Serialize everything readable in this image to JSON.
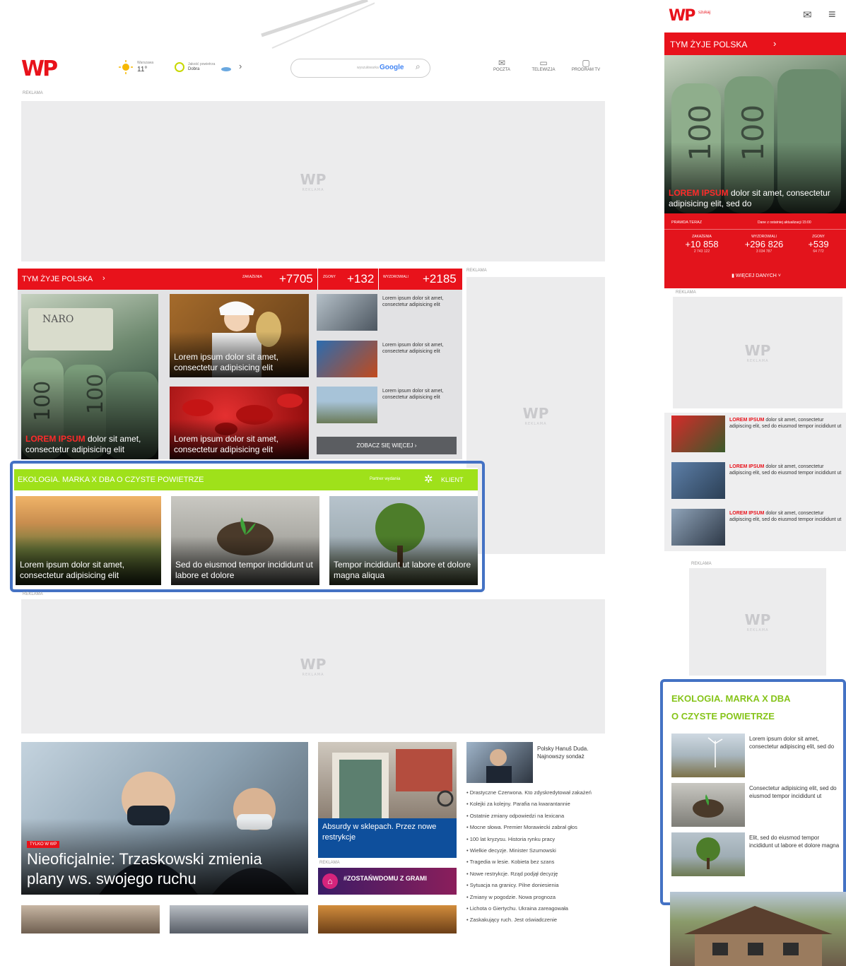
{
  "header": {
    "weather_label": "Warszawa",
    "weather_temp": "11°",
    "air_label": "Jakość powietrza",
    "air_value": "Dobra",
    "search_brand": "Google",
    "search_prefix": "wyszukiwarka",
    "nav": [
      {
        "label": "POCZTA",
        "icon": "mail-icon"
      },
      {
        "label": "TELEWIZJA",
        "icon": "tv-icon"
      },
      {
        "label": "PROGRAM TV",
        "icon": "calendar-icon"
      }
    ],
    "ad_label": "REKLAMA"
  },
  "placeholder": {
    "logo": "WP",
    "sub": "REKLAMA"
  },
  "poland_section": {
    "title": "TYM ŻYJE POLSKA",
    "stats": [
      {
        "label": "ZAKAŻENIA",
        "value": "+7705"
      },
      {
        "label": "ZGONY",
        "value": "+132"
      },
      {
        "label": "WYZDROWIALI",
        "value": "+2185"
      }
    ],
    "big_story": {
      "highlight": "LOREM IPSUM",
      "text": " dolor sit amet, consectetur adipisicing elit"
    },
    "mid_stories": [
      "Lorem ipsum dolor sit amet, consectetur adipisicing elit",
      "Lorem ipsum dolor sit amet, consectetur adipisicing elit"
    ],
    "small_stories": [
      "Lorem ipsum dolor sit amet, consectetur adipisicing elit",
      "Lorem ipsum dolor sit amet, consectetur adipisicing elit",
      "Lorem ipsum dolor sit amet, consectetur adipisicing elit"
    ],
    "more_button": "ZOBACZ SIĘ WIĘCEJ"
  },
  "eco_section": {
    "title": "EKOLOGIA. MARKA X DBA O CZYSTE POWIETRZE",
    "partner_label": "Partner wydania",
    "client_label": "KLIENT",
    "stories": [
      "Lorem ipsum dolor sit amet, consectetur adipisicing elit",
      "Sed do eiusmod tempor incididunt ut labore et dolore",
      "Tempor incididunt ut labore et dolore magna aliqua"
    ]
  },
  "lower": {
    "main_badge": "TYLKO W WP",
    "main_title": "Nieoficjalnie: Trzaskowski zmienia plany ws. swojego ruchu",
    "shop_title": "Absurdy w sklepach. Przez nowe restrykcje",
    "banner_text": "#ZOSTAŃWDOMU Z GRAMI",
    "top_news_title": "Polsky Hanuš Duda. Najnowszy sondaż",
    "news_list": [
      "Drastyczne Czerwona. Kto zdyskredytował zakażeń",
      "Kolejki za kolejny. Parafia na kwarantannie",
      "Ostatnie zmiany odpowiedzi na lexicana",
      "Mocne słowa. Premier Morawiecki zabrał głos",
      "100 lat kryzysu. Historia rynku pracy",
      "Wielkie decyzje. Minister Szumowski",
      "Tragedia w lesie. Kobieta bez szans",
      "Nowe restrykcje. Rząd podjął decyzję",
      "Sytuacja na granicy. Pilne doniesienia",
      "Zmiany w pogodzie. Nowa prognoza",
      "Lichota o Giertychu. Ukraina zareagowała",
      "Zaskakujący ruch. Jest oświadczenie"
    ]
  },
  "mobile": {
    "logo": "WP",
    "search_hint": "szukaj",
    "poland_title": "TYM ŻYJE POLSKA",
    "hero": {
      "highlight": "LOREM IPSUM",
      "text": " dolor sit amet, consectetur adipisicing elit, sed do"
    },
    "stats_caption": "PRAWDA TERAZ",
    "stats_update": "Dane z ostatniej aktualizacji 15:00",
    "stats": [
      {
        "label": "ZAKAŻENIA",
        "value": "+10 858",
        "sub": "2 743 122"
      },
      {
        "label": "WYZDROWIALI",
        "value": "+296 826",
        "sub": "3 034 787"
      },
      {
        "label": "ZGONY",
        "value": "+539",
        "sub": "64 772"
      }
    ],
    "more_data": "WIĘCEJ DANYCH",
    "list": [
      {
        "highlight": "LOREM IPSUM",
        "text": " dolor sit amet, consectetur adipiscing elit, sed do eiusmod tempor incididunt ut"
      },
      {
        "highlight": "LOREM IPSUM",
        "text": " dolor sit amet, consectetur adipiscing elit, sed do eiusmod tempor incididunt ut"
      },
      {
        "highlight": "LOREM IPSUM",
        "text": " dolor sit amet, consectetur adipiscing elit, sed do eiusmod tempor incididunt ut"
      }
    ],
    "eco_title_1": "EKOLOGIA. MARKA X DBA",
    "eco_title_2": "O CZYSTE POWIETRZE",
    "eco_items": [
      "Lorem ipsum dolor sit amet, consectetur adipiscing elit, sed do",
      "Consectetur adipisicing elit, sed do eiusmod tempor incididunt ut",
      "Elit, sed do eiusmod tempor incididunt ut labore et dolore magna"
    ]
  },
  "colors": {
    "red": "#e8121b",
    "green": "#9fe11a",
    "highlight_box": "#4472c4"
  }
}
